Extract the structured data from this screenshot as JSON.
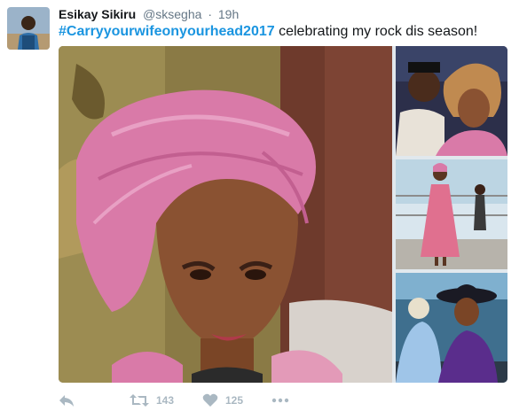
{
  "tweet": {
    "author_name": "Esikay Sikiru",
    "handle": "@sksegha",
    "separator": "·",
    "time": "19h",
    "hashtag": "#Carryyourwifeonyourhead2017",
    "text_rest": " celebrating my rock dis season!"
  },
  "actions": {
    "reply_icon": "reply-icon",
    "retweet_icon": "retweet-icon",
    "retweet_count": "143",
    "like_icon": "heart-icon",
    "like_count": "125",
    "more_icon": "more-icon"
  },
  "colors": {
    "hashtag": "#1b95e0",
    "muted": "#657786",
    "action": "#aab8c2",
    "gele_pink": "#d97aa8"
  }
}
